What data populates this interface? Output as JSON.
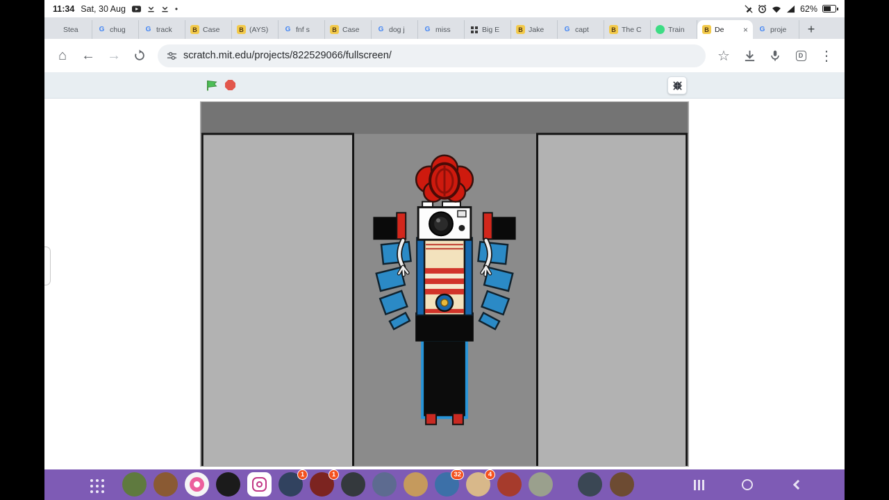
{
  "status_bar": {
    "time": "11:34",
    "date": "Sat, 30 Aug",
    "battery_percent": "62%",
    "left_icons": [
      "youtube-icon",
      "download-done-icon",
      "download-done-icon",
      "dot"
    ],
    "right_icons": [
      "pencil-off-icon",
      "alarm-icon",
      "wifi-icon",
      "signal-icon",
      "battery-icon"
    ]
  },
  "tab_strip": {
    "tabs": [
      {
        "label": "Stea",
        "favicon": "none"
      },
      {
        "label": "chug",
        "favicon": "google"
      },
      {
        "label": "track",
        "favicon": "google"
      },
      {
        "label": "Case",
        "favicon": "b"
      },
      {
        "label": "(AYS)",
        "favicon": "b"
      },
      {
        "label": "fnf s",
        "favicon": "google"
      },
      {
        "label": "Case",
        "favicon": "b"
      },
      {
        "label": "dog j",
        "favicon": "google"
      },
      {
        "label": "miss",
        "favicon": "google"
      },
      {
        "label": "Big E",
        "favicon": "grid"
      },
      {
        "label": "Jake",
        "favicon": "b"
      },
      {
        "label": "capt",
        "favicon": "google"
      },
      {
        "label": "The C",
        "favicon": "b"
      },
      {
        "label": "Train",
        "favicon": "android"
      },
      {
        "label": "De",
        "favicon": "b",
        "active": true
      },
      {
        "label": "proje",
        "favicon": "google"
      }
    ],
    "new_tab": "+"
  },
  "toolbar": {
    "url": "scratch.mit.edu/projects/822529066/fullscreen/",
    "icons": [
      "home-icon",
      "back-icon",
      "forward-icon",
      "reload-icon",
      "site-info-icon",
      "star-icon",
      "download-icon",
      "mic-icon",
      "d-square-icon",
      "menu-icon"
    ]
  },
  "scratch_player": {
    "controls": [
      "green-flag-icon",
      "stop-sign-icon"
    ],
    "fullscreen_toggle": "collapse-icon",
    "stage_background": "#8b8b8b"
  },
  "taskbar": {
    "color": "#7e5bb5",
    "apps": [
      {
        "name": "app-1",
        "color": "#5f7a3f"
      },
      {
        "name": "app-2",
        "color": "#8a5a33"
      },
      {
        "name": "app-3",
        "color": "#f5f5f5",
        "type": "flower"
      },
      {
        "name": "app-4",
        "color": "#1b1b1b"
      },
      {
        "name": "app-5",
        "color": "#ffffff",
        "type": "instagram"
      },
      {
        "name": "app-6",
        "color": "#31425f",
        "badge": "1"
      },
      {
        "name": "app-7",
        "color": "#7c2420",
        "badge": "1"
      },
      {
        "name": "app-8",
        "color": "#34393d"
      },
      {
        "name": "app-9",
        "color": "#5d6b90"
      },
      {
        "name": "app-10",
        "color": "#c59a5d"
      },
      {
        "name": "app-11",
        "color": "#3c70a8",
        "badge": "32"
      },
      {
        "name": "app-12",
        "color": "#d8b88a",
        "badge": "4"
      },
      {
        "name": "app-13",
        "color": "#a63b2c"
      },
      {
        "name": "app-14",
        "color": "#9aa08d"
      }
    ],
    "apps_right": [
      {
        "name": "app-15",
        "color": "#3a4754"
      },
      {
        "name": "app-16",
        "color": "#6d4b32"
      }
    ],
    "nav_buttons": [
      "recents-icon",
      "home-circle-icon",
      "back-chevron-icon"
    ]
  }
}
